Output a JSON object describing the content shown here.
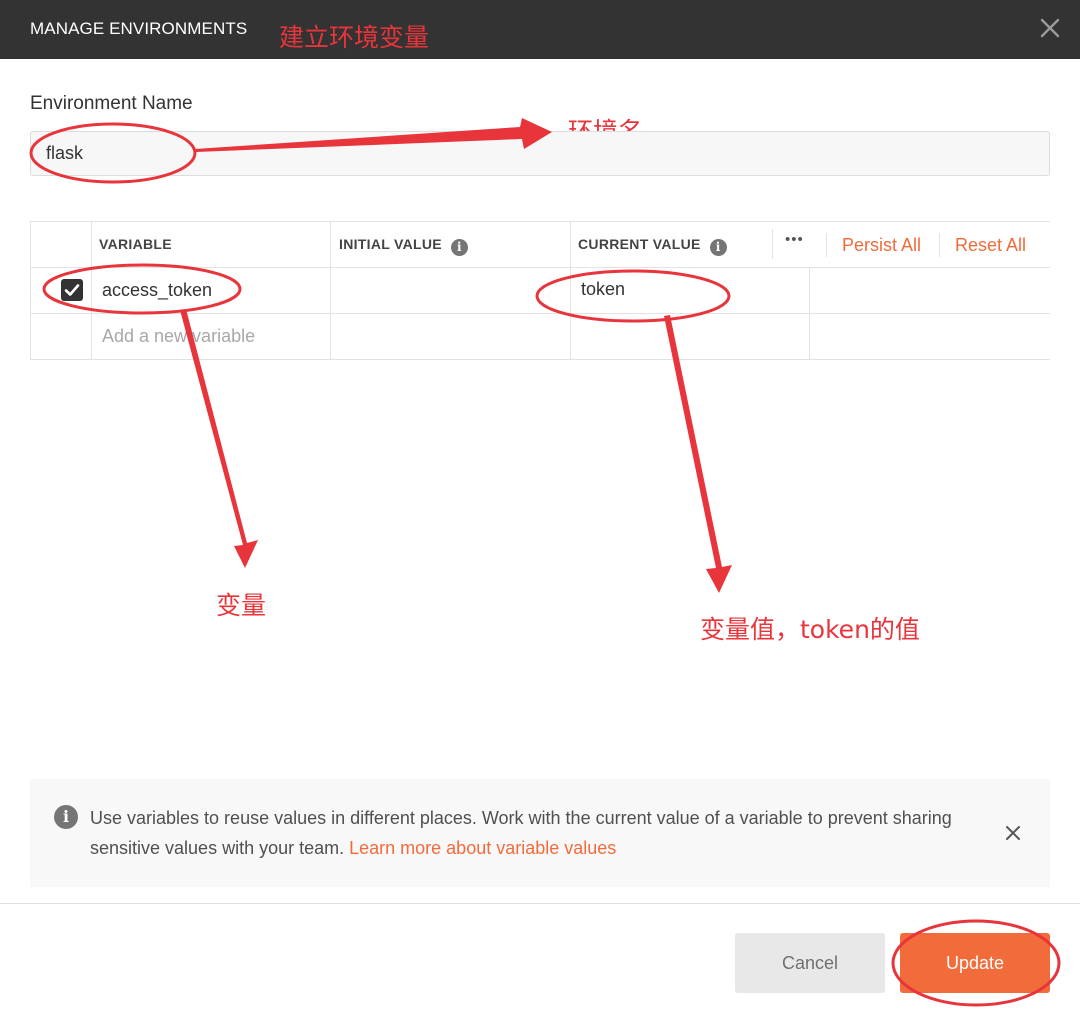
{
  "dialog": {
    "title": "MANAGE ENVIRONMENTS",
    "close_icon": "close-icon"
  },
  "environment": {
    "name_label": "Environment Name",
    "name_value": "flask"
  },
  "table": {
    "columns": [
      "VARIABLE",
      "INITIAL VALUE",
      "CURRENT VALUE"
    ],
    "more_label": "•••",
    "persist_all_label": "Persist All",
    "reset_all_label": "Reset All",
    "rows": [
      {
        "checked": true,
        "variable": "access_token",
        "initial_value": "",
        "current_value": "token"
      }
    ],
    "new_variable_placeholder": "Add a new variable"
  },
  "info_banner": {
    "text": "Use variables to reuse values in different places. Work with the current value of a variable to prevent sharing sensitive values with your team.",
    "link": "Learn more about variable values"
  },
  "footer": {
    "cancel_label": "Cancel",
    "update_label": "Update"
  },
  "annotations": {
    "title_note": "建立环境变量",
    "env_name_note": "环境名",
    "variable_note": "变量",
    "value_note": "变量值，token的值"
  },
  "colors": {
    "header_bg": "#333333",
    "accent": "#f26b3a",
    "annotation": "#e8343b"
  }
}
